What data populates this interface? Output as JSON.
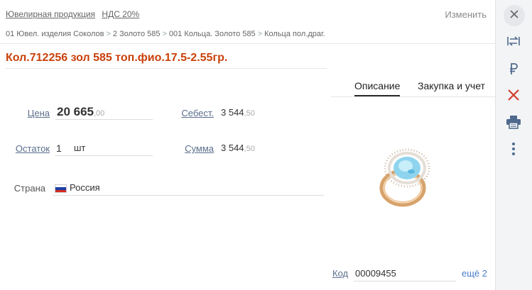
{
  "header": {
    "category_link": "Ювелирная продукция",
    "vat_link": "НДС 20%",
    "edit_label": "Изменить"
  },
  "breadcrumb": [
    "01 Ювел. изделия Соколов",
    "2 Золото 585",
    "001 Кольца. Золото 585",
    "Кольца пол.драг."
  ],
  "product": {
    "title": "Кол.712256 зол 585 топ.фио.17.5-2.55гр."
  },
  "tabs": [
    {
      "label": "Описание",
      "active": true
    },
    {
      "label": "Закупка и учет",
      "active": false
    }
  ],
  "fields": {
    "price_label": "Цена",
    "price_int": "20 665",
    "price_dec": ",00",
    "cost_label": "Себест.",
    "cost_int": "3 544",
    "cost_dec": ",50",
    "stock_label": "Остаток",
    "stock_value": "1",
    "stock_unit": "шт",
    "sum_label": "Сумма",
    "sum_int": "3 544",
    "sum_dec": ",50",
    "country_label": "Страна",
    "country_value": "Россия"
  },
  "code": {
    "label": "Код",
    "value": "00009455",
    "more": "ещё 2"
  },
  "rail": {
    "icons": [
      "close-icon",
      "swap-icon",
      "ruble-icon",
      "delete-icon",
      "print-icon",
      "more-vertical-icon"
    ]
  },
  "colors": {
    "title": "#c9410b",
    "link": "#5b6f8d",
    "delete": "#d0402c"
  }
}
